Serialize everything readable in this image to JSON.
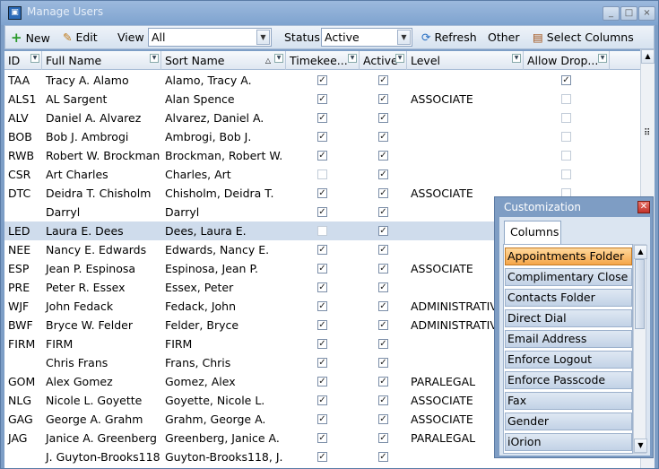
{
  "window": {
    "title": "Manage Users",
    "min": "_",
    "max": "□",
    "close": "×"
  },
  "toolbar": {
    "new_label": "New",
    "edit_label": "Edit",
    "view_label": "View",
    "view_value": "All",
    "status_label": "Status",
    "status_value": "Active",
    "refresh_label": "Refresh",
    "other_label": "Other",
    "select_columns_label": "Select Columns"
  },
  "columns": [
    "ID",
    "Full Name",
    "Sort Name",
    "Timekee...",
    "Active",
    "Level",
    "Allow Drop..."
  ],
  "rows": [
    {
      "id": "TAA",
      "full": "Tracy A. Alamo",
      "sort": "Alamo, Tracy A.",
      "time": true,
      "active": true,
      "level": "",
      "drop": true
    },
    {
      "id": "ALS1",
      "full": "AL  Sargent",
      "sort": "Alan Spence",
      "time": true,
      "active": true,
      "level": "ASSOCIATE",
      "drop": false
    },
    {
      "id": "ALV",
      "full": "Daniel A. Alvarez",
      "sort": "Alvarez, Daniel A.",
      "time": true,
      "active": true,
      "level": "",
      "drop": false
    },
    {
      "id": "BOB",
      "full": "Bob J. Ambrogi",
      "sort": "Ambrogi, Bob J.",
      "time": true,
      "active": true,
      "level": "",
      "drop": false
    },
    {
      "id": "RWB",
      "full": "Robert W. Brockman",
      "sort": "Brockman, Robert W.",
      "time": true,
      "active": true,
      "level": "",
      "drop": false
    },
    {
      "id": "CSR",
      "full": "Art Charles",
      "sort": "Charles, Art",
      "time": false,
      "active": true,
      "level": "",
      "drop": false
    },
    {
      "id": "DTC",
      "full": "Deidra T. Chisholm",
      "sort": "Chisholm, Deidra T.",
      "time": true,
      "active": true,
      "level": "ASSOCIATE",
      "drop": false
    },
    {
      "id": "",
      "full": "Darryl",
      "sort": "Darryl",
      "time": true,
      "active": true,
      "level": "",
      "drop": null
    },
    {
      "id": "LED",
      "full": "Laura E. Dees",
      "sort": "Dees, Laura E.",
      "time": false,
      "active": true,
      "level": "",
      "drop": null
    },
    {
      "id": "NEE",
      "full": "Nancy E. Edwards",
      "sort": "Edwards, Nancy E.",
      "time": true,
      "active": true,
      "level": "",
      "drop": null
    },
    {
      "id": "ESP",
      "full": "Jean P. Espinosa",
      "sort": "Espinosa, Jean P.",
      "time": true,
      "active": true,
      "level": "ASSOCIATE",
      "drop": null
    },
    {
      "id": "PRE",
      "full": "Peter R. Essex",
      "sort": "Essex, Peter",
      "time": true,
      "active": true,
      "level": "",
      "drop": null
    },
    {
      "id": "WJF",
      "full": "John Fedack",
      "sort": "Fedack, John",
      "time": true,
      "active": true,
      "level": "ADMINISTRATIV",
      "drop": null
    },
    {
      "id": "BWF",
      "full": "Bryce W. Felder",
      "sort": "Felder, Bryce",
      "time": true,
      "active": true,
      "level": "ADMINISTRATIV",
      "drop": null
    },
    {
      "id": "FIRM",
      "full": "FIRM",
      "sort": "FIRM",
      "time": true,
      "active": true,
      "level": "",
      "drop": null
    },
    {
      "id": "",
      "full": "Chris Frans",
      "sort": "Frans, Chris",
      "time": true,
      "active": true,
      "level": "",
      "drop": null
    },
    {
      "id": "GOM",
      "full": "Alex Gomez",
      "sort": "Gomez, Alex",
      "time": true,
      "active": true,
      "level": "PARALEGAL",
      "drop": null
    },
    {
      "id": "NLG",
      "full": "Nicole L. Goyette",
      "sort": "Goyette, Nicole L.",
      "time": true,
      "active": true,
      "level": "ASSOCIATE",
      "drop": null
    },
    {
      "id": "GAG",
      "full": "George A. Grahm",
      "sort": "Grahm, George A.",
      "time": true,
      "active": true,
      "level": "ASSOCIATE",
      "drop": null
    },
    {
      "id": "JAG",
      "full": "Janice A. Greenberg",
      "sort": "Greenberg, Janice A.",
      "time": true,
      "active": true,
      "level": "PARALEGAL",
      "drop": null
    },
    {
      "id": "",
      "full": "J. Guyton-Brooks118",
      "sort": "Guyton-Brooks118, J.",
      "time": true,
      "active": true,
      "level": "",
      "drop": null
    }
  ],
  "customization": {
    "title": "Customization",
    "tab": "Columns",
    "items": [
      "Appointments Folder",
      "Complimentary Close",
      "Contacts Folder",
      "Direct Dial",
      "Email Address",
      "Enforce Logout",
      "Enforce Passcode",
      "Fax",
      "Gender",
      "iOrion"
    ]
  }
}
